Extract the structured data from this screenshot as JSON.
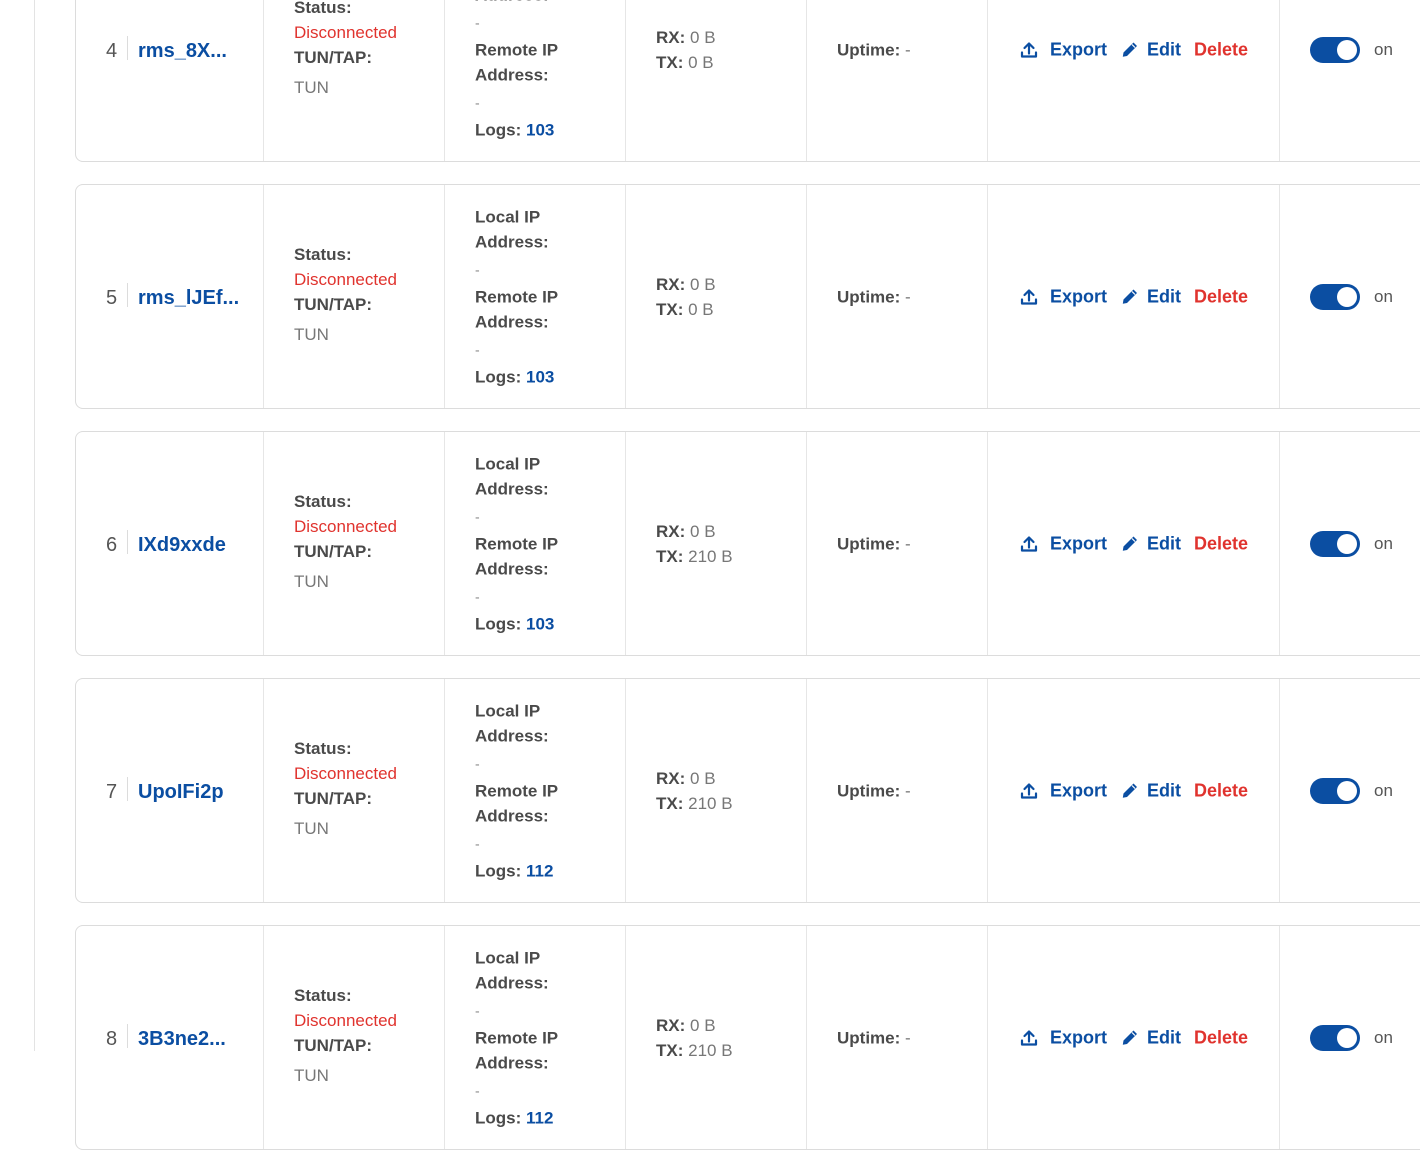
{
  "labels": {
    "status": "Status:",
    "tun_tap": "TUN/TAP:",
    "local_ip_1": "Local IP",
    "remote_ip_1": "Remote IP",
    "address": "Address:",
    "logs": "Logs:",
    "rx": "RX:",
    "tx": "TX:",
    "uptime": "Uptime:",
    "export": "Export",
    "edit": "Edit",
    "delete": "Delete",
    "on": "on"
  },
  "colors": {
    "accent": "#0b4ea2",
    "danger": "#e0332e"
  },
  "icons": {
    "export": "upload-icon",
    "edit": "pencil-icon"
  },
  "rows": [
    {
      "index": "4",
      "name": "rms_8X...",
      "status": "Disconnected",
      "tun_tap": "TUN",
      "local_ip": "-",
      "remote_ip": "-",
      "logs": "103",
      "rx": "0 B",
      "tx": "0 B",
      "uptime": "-",
      "enabled": true
    },
    {
      "index": "5",
      "name": "rms_lJEf...",
      "status": "Disconnected",
      "tun_tap": "TUN",
      "local_ip": "-",
      "remote_ip": "-",
      "logs": "103",
      "rx": "0 B",
      "tx": "0 B",
      "uptime": "-",
      "enabled": true
    },
    {
      "index": "6",
      "name": "IXd9xxde",
      "status": "Disconnected",
      "tun_tap": "TUN",
      "local_ip": "-",
      "remote_ip": "-",
      "logs": "103",
      "rx": "0 B",
      "tx": "210 B",
      "uptime": "-",
      "enabled": true
    },
    {
      "index": "7",
      "name": "UpoIFi2p",
      "status": "Disconnected",
      "tun_tap": "TUN",
      "local_ip": "-",
      "remote_ip": "-",
      "logs": "112",
      "rx": "0 B",
      "tx": "210 B",
      "uptime": "-",
      "enabled": true
    },
    {
      "index": "8",
      "name": "3B3ne2...",
      "status": "Disconnected",
      "tun_tap": "TUN",
      "local_ip": "-",
      "remote_ip": "-",
      "logs": "112",
      "rx": "0 B",
      "tx": "210 B",
      "uptime": "-",
      "enabled": true
    }
  ]
}
